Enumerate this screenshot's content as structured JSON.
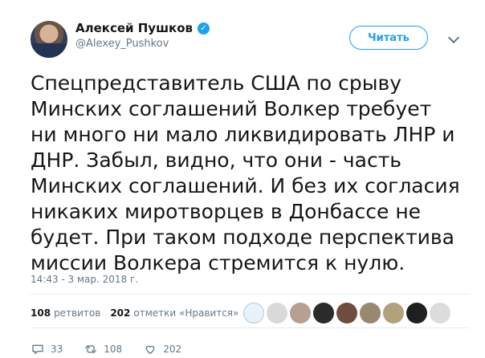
{
  "user": {
    "name": "Алексей Пушков",
    "handle": "@Alexey_Pushkov",
    "verified_icon": "verified-badge-icon"
  },
  "follow_label": "Читать",
  "tweet": {
    "text": "Спецпредставитель США по срыву Минских соглашений Волкер требует ни много ни мало ликвидировать ЛНР и ДНР. Забыл, видно, что они - часть Минских соглашений. И без их согласия никаких миротворцев в Донбассе не будет. При таком подходе перспектива миссии Волкера стремится к нулю.",
    "timestamp": "14:43 - 3 мар. 2018 г."
  },
  "stats": {
    "retweets_count": "108",
    "retweets_label": "ретвитов",
    "likes_count": "202",
    "likes_label": "отметки «Нравится»"
  },
  "actions": {
    "reply_count": "33",
    "retweet_count": "108",
    "like_count": "202"
  },
  "colors": {
    "accent": "#1da1f2",
    "text": "#14171a",
    "muted": "#657786"
  }
}
